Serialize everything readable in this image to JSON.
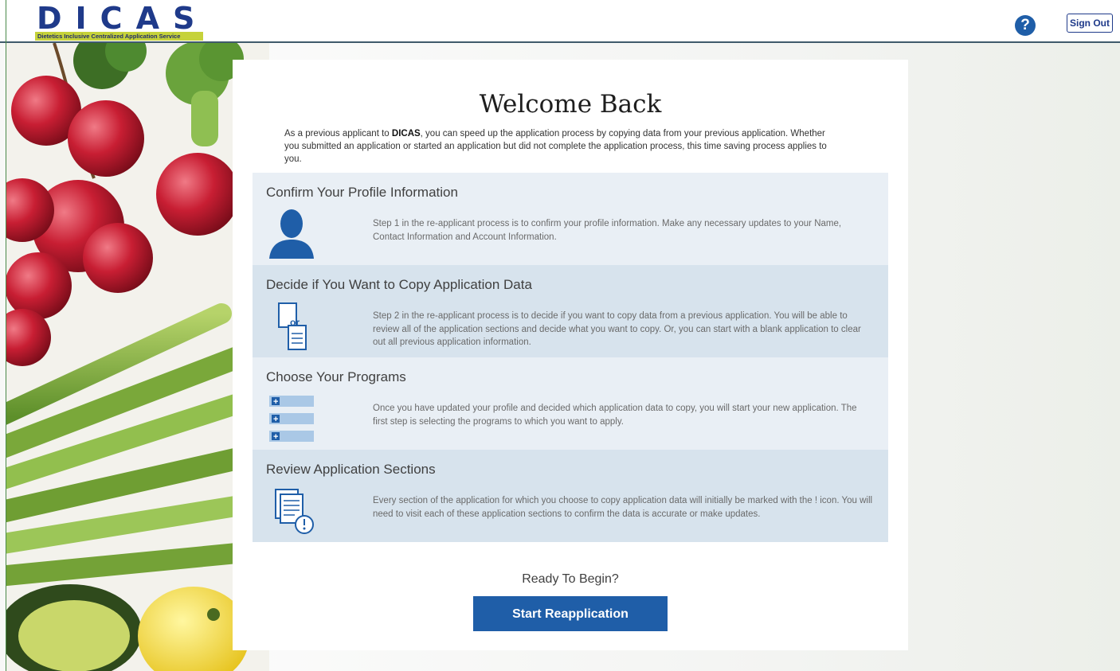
{
  "header": {
    "logo_text": "DICAS",
    "logo_tagline": "Dietetics Inclusive Centralized Application Service",
    "help_label": "?",
    "signout_label": "Sign Out"
  },
  "main": {
    "title": "Welcome Back",
    "intro_prefix": "As a previous applicant to ",
    "intro_brand": "DICAS",
    "intro_suffix": ", you can speed up the application process by copying data from your previous application. Whether you submitted an application or started an application but did not complete the application process, this time saving process applies to you.",
    "steps": [
      {
        "title": "Confirm Your Profile Information",
        "icon": "user-icon",
        "text": "Step 1 in the re-applicant process is to confirm your profile information. Make any necessary updates to your Name, Contact Information and Account Information."
      },
      {
        "title": "Decide if You Want to Copy Application Data",
        "icon": "copy-documents-icon",
        "icon_label": "or",
        "text": "Step 2 in the re-applicant process is to decide if you want to copy data from a previous application. You will be able to review all of the application sections and decide what you want to copy. Or, you can start with a blank application to clear out all previous application information."
      },
      {
        "title": "Choose Your Programs",
        "icon": "program-list-icon",
        "text": "Once you have updated your profile and decided which application data to copy, you will start your new application. The first step is selecting the programs to which you want to apply."
      },
      {
        "title": "Review Application Sections",
        "icon": "review-document-icon",
        "text": "Every section of the application for which you choose to copy application data will initially be marked with the ! icon. You will need to visit each of these application sections to confirm the data is accurate or make updates."
      }
    ],
    "ready_text": "Ready To Begin?",
    "start_button": "Start Reapplication"
  },
  "colors": {
    "brand_blue": "#1f5ea8",
    "logo_navy": "#1f3a8a",
    "logo_tag": "#c6d23a",
    "step_light": "#e9eff5",
    "step_dark": "#d7e3ed"
  }
}
